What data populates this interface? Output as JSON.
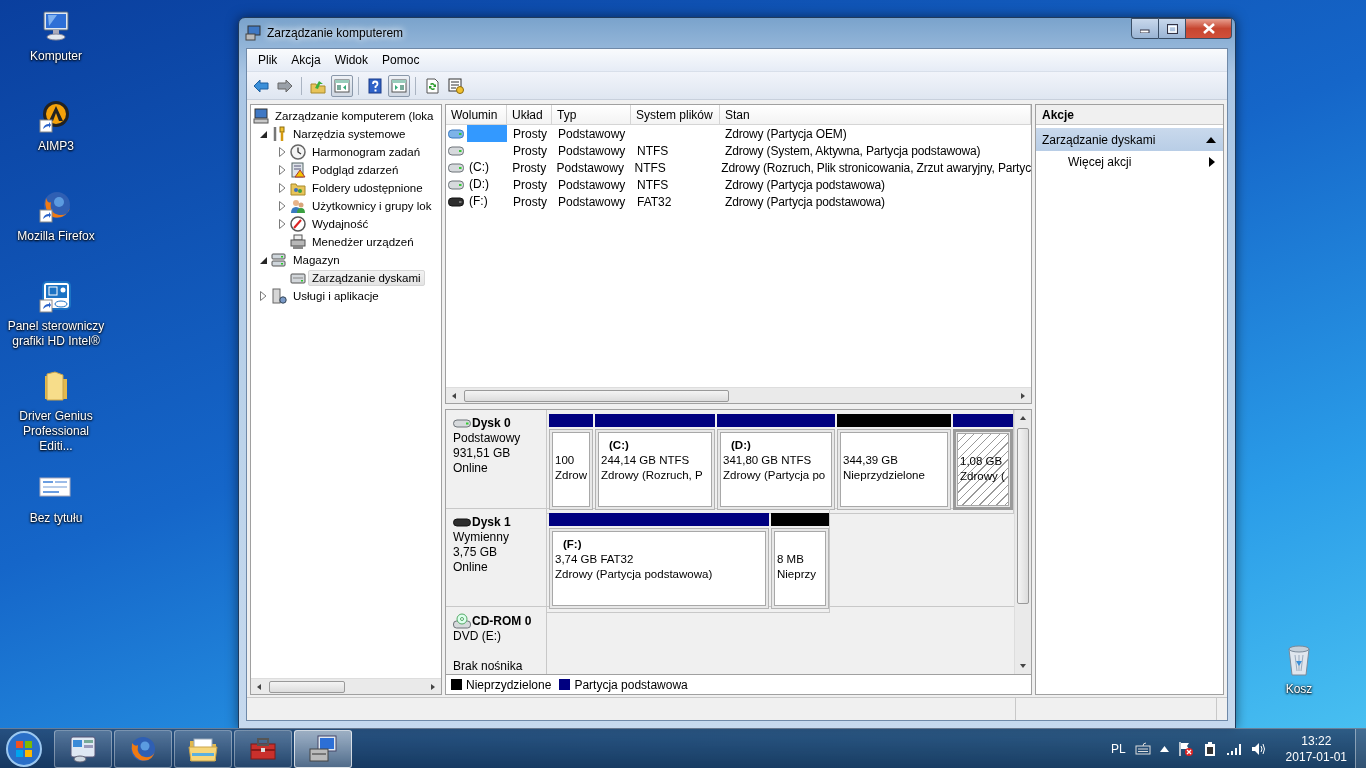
{
  "desktop_icons": [
    {
      "label": "Komputer",
      "kind": "computer",
      "shortcut": false
    },
    {
      "label": "AIMP3",
      "kind": "player",
      "shortcut": true
    },
    {
      "label": "Mozilla Firefox",
      "kind": "browser",
      "shortcut": true
    },
    {
      "label": "Panel sterowniczy grafiki HD Intel®",
      "kind": "graphics",
      "shortcut": true
    },
    {
      "label": "Driver Genius Professional Editi...",
      "kind": "folder",
      "shortcut": false
    },
    {
      "label": "Bez tytułu",
      "kind": "image",
      "shortcut": false
    },
    {
      "label": "Kosz",
      "kind": "trash",
      "shortcut": false
    }
  ],
  "window": {
    "title": "Zarządzanie komputerem"
  },
  "menu": [
    "Plik",
    "Akcja",
    "Widok",
    "Pomoc"
  ],
  "toolbar": [
    {
      "kind": "back",
      "on": false
    },
    {
      "kind": "forward",
      "on": false
    },
    {
      "kind": "up",
      "on": false
    },
    {
      "kind": "tree",
      "on": true
    },
    {
      "kind": "help",
      "on": false
    },
    {
      "kind": "pane",
      "on": true
    },
    {
      "kind": "refresh",
      "on": false
    },
    {
      "kind": "properties",
      "on": false
    }
  ],
  "tree": [
    {
      "label": "Zarządzanie komputerem (loka",
      "kind": "computer",
      "selected": false,
      "children": [
        {
          "label": "Narzędzia systemowe",
          "kind": "tools",
          "expanded": true,
          "selected": false,
          "children": [
            {
              "label": "Harmonogram zadań",
              "kind": "clock",
              "expanded": false,
              "selected": false
            },
            {
              "label": "Podgląd zdarzeń",
              "kind": "log",
              "expanded": false,
              "selected": false
            },
            {
              "label": "Foldery udostępnione",
              "kind": "share",
              "expanded": false,
              "selected": false
            },
            {
              "label": "Użytkownicy i grupy lok",
              "kind": "users",
              "expanded": false,
              "selected": false
            },
            {
              "label": "Wydajność",
              "kind": "gauge",
              "expanded": false,
              "selected": false
            },
            {
              "label": "Menedżer urządzeń",
              "kind": "devices",
              "selected": false
            }
          ]
        },
        {
          "label": "Magazyn",
          "kind": "storage",
          "expanded": true,
          "selected": false,
          "children": [
            {
              "label": "Zarządzanie dyskami",
              "kind": "disk",
              "selected": true
            }
          ]
        },
        {
          "label": "Usługi i aplikacje",
          "kind": "services",
          "expanded": false,
          "selected": false
        }
      ]
    }
  ],
  "volumes": {
    "columns": [
      "Wolumin",
      "Układ",
      "Typ",
      "System plików",
      "Stan"
    ],
    "rows": [
      {
        "kind": "hdd",
        "selected": true,
        "layout": "Prosty",
        "type": "Podstawowy",
        "status": "Zdrowy (Partycja OEM)"
      },
      {
        "kind": "hdd",
        "selected": false,
        "layout": "Prosty",
        "type": "Podstawowy",
        "file_system": "NTFS",
        "status": "Zdrowy (System, Aktywna, Partycja podstawowa)"
      },
      {
        "kind": "hdd",
        "selected": false,
        "volume": "(C:)",
        "layout": "Prosty",
        "type": "Podstawowy",
        "file_system": "NTFS",
        "status": "Zdrowy (Rozruch, Plik stronicowania, Zrzut awaryjny, Partyc"
      },
      {
        "kind": "hdd",
        "selected": false,
        "volume": "(D:)",
        "layout": "Prosty",
        "type": "Podstawowy",
        "file_system": "NTFS",
        "status": "Zdrowy (Partycja podstawowa)"
      },
      {
        "kind": "removable",
        "selected": false,
        "volume": "(F:)",
        "layout": "Prosty",
        "type": "Podstawowy",
        "file_system": "FAT32",
        "status": "Zdrowy (Partycja podstawowa)"
      }
    ]
  },
  "disks": [
    {
      "name": "Dysk 0",
      "kind": "hdd",
      "lines": [
        "Podstawowy",
        "931,51 GB",
        "Online"
      ],
      "partitions": [
        {
          "color": "#000080",
          "selected": false,
          "size": "100",
          "status": "Zdrow"
        },
        {
          "color": "#000080",
          "selected": false,
          "label": "(C:)",
          "size": "244,14 GB NTFS",
          "status": "Zdrowy (Rozruch, P"
        },
        {
          "color": "#000080",
          "selected": false,
          "label": "(D:)",
          "size": "341,80 GB NTFS",
          "status": "Zdrowy (Partycja po"
        },
        {
          "color": "#000000",
          "selected": false,
          "size": "344,39 GB",
          "status": "Nieprzydzielone"
        },
        {
          "color": "#000080",
          "selected": true,
          "size": "1,08 GB",
          "status": "Zdrowy ("
        }
      ]
    },
    {
      "name": "Dysk 1",
      "kind": "removable",
      "lines": [
        "Wymienny",
        "3,75 GB",
        "Online"
      ],
      "partitions": [
        {
          "color": "#000080",
          "selected": false,
          "label": "(F:)",
          "size": "3,74 GB FAT32",
          "status": "Zdrowy (Partycja podstawowa)"
        },
        {
          "color": "#000000",
          "selected": false,
          "size": "8 MB",
          "status": "Nieprzy"
        }
      ]
    },
    {
      "name": "CD-ROM 0",
      "kind": "cdrom",
      "lines": [
        "DVD (E:)",
        "Brak nośnika"
      ]
    }
  ],
  "legend": [
    {
      "label": "Nieprzydzielone",
      "color": "#000000"
    },
    {
      "label": "Partycja podstawowa",
      "color": "#000080"
    }
  ],
  "actions": {
    "title": "Akcje",
    "sections": [
      {
        "title": "Zarządzanie dyskami",
        "expanded": true,
        "items": [
          {
            "label": "Więcej akcji",
            "submenu": true
          }
        ]
      }
    ]
  },
  "taskbar": {
    "apps": [
      {
        "kind": "control-panel",
        "selected": false
      },
      {
        "kind": "browser",
        "selected": false
      },
      {
        "kind": "explorer",
        "selected": false
      },
      {
        "kind": "toolbox",
        "selected": false
      },
      {
        "kind": "computer-management",
        "selected": true
      }
    ],
    "language": "PL",
    "time": "13:22",
    "date": "2017-01-01"
  }
}
